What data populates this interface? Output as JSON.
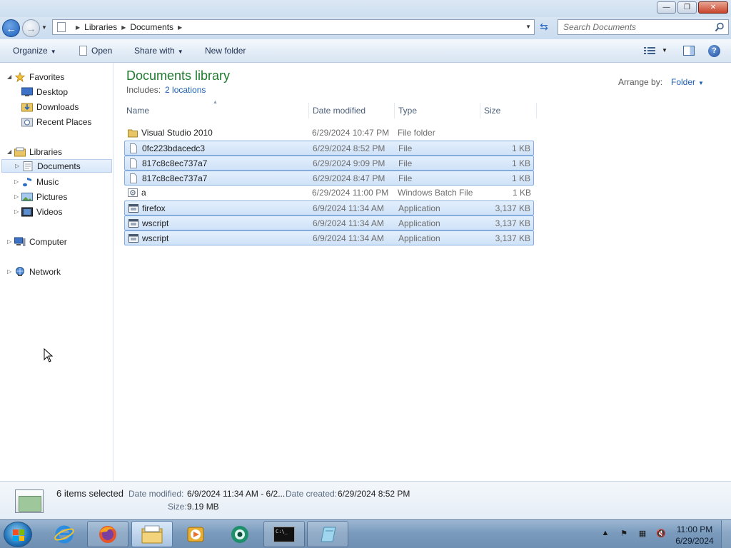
{
  "window": {
    "buttons": {
      "minimize": "—",
      "maximize": "❐",
      "close": "✕"
    }
  },
  "address": {
    "crumbs": [
      "Libraries",
      "Documents"
    ],
    "search_placeholder": "Search Documents"
  },
  "toolbar": {
    "organize": "Organize",
    "open": "Open",
    "share_with": "Share with",
    "new_folder": "New folder"
  },
  "nav": {
    "favorites": {
      "label": "Favorites",
      "items": [
        "Desktop",
        "Downloads",
        "Recent Places"
      ]
    },
    "libraries": {
      "label": "Libraries",
      "items": [
        "Documents",
        "Music",
        "Pictures",
        "Videos"
      ]
    },
    "computer": "Computer",
    "network": "Network"
  },
  "library": {
    "title": "Documents library",
    "includes_label": "Includes:",
    "includes_link": "2 locations",
    "arrange_label": "Arrange by:",
    "arrange_value": "Folder"
  },
  "columns": {
    "name": "Name",
    "date": "Date modified",
    "type": "Type",
    "size": "Size"
  },
  "files": [
    {
      "name": "Visual Studio 2010",
      "date": "6/29/2024 10:47 PM",
      "type": "File folder",
      "size": "",
      "icon": "folder-icon",
      "selected": false
    },
    {
      "name": "0fc223bdacedc3",
      "date": "6/29/2024 8:52 PM",
      "type": "File",
      "size": "1 KB",
      "icon": "file-icon",
      "selected": true
    },
    {
      "name": "817c8c8ec737a7",
      "date": "6/29/2024 9:09 PM",
      "type": "File",
      "size": "1 KB",
      "icon": "file-icon",
      "selected": true
    },
    {
      "name": "817c8c8ec737a7",
      "date": "6/29/2024 8:47 PM",
      "type": "File",
      "size": "1 KB",
      "icon": "file-icon",
      "selected": true
    },
    {
      "name": "a",
      "date": "6/29/2024 11:00 PM",
      "type": "Windows Batch File",
      "size": "1 KB",
      "icon": "batch-file-icon",
      "selected": false
    },
    {
      "name": "firefox",
      "date": "6/9/2024 11:34 AM",
      "type": "Application",
      "size": "3,137 KB",
      "icon": "application-icon",
      "selected": true
    },
    {
      "name": "wscript",
      "date": "6/9/2024 11:34 AM",
      "type": "Application",
      "size": "3,137 KB",
      "icon": "application-icon",
      "selected": true
    },
    {
      "name": "wscript",
      "date": "6/9/2024 11:34 AM",
      "type": "Application",
      "size": "3,137 KB",
      "icon": "application-icon",
      "selected": true
    }
  ],
  "details": {
    "count": "6 items selected",
    "date_modified_label": "Date modified:",
    "date_modified_value": "6/9/2024 11:34 AM - 6/2...",
    "date_created_label": "Date created:",
    "date_created_value": "6/29/2024 8:52 PM",
    "size_label": "Size:",
    "size_value": "9.19 MB"
  },
  "taskbar": {
    "apps": [
      "internet-explorer-icon",
      "firefox-icon",
      "explorer-icon",
      "media-player-icon",
      "webcam-icon",
      "cmd-icon",
      "notepad-icon"
    ],
    "cmd_text": "C:\\_",
    "clock_time": "11:00 PM",
    "clock_date": "6/29/2024"
  },
  "colors": {
    "title_green": "#1e7a2e",
    "link_blue": "#1e5fb4",
    "selection": "#cfe2f8"
  }
}
